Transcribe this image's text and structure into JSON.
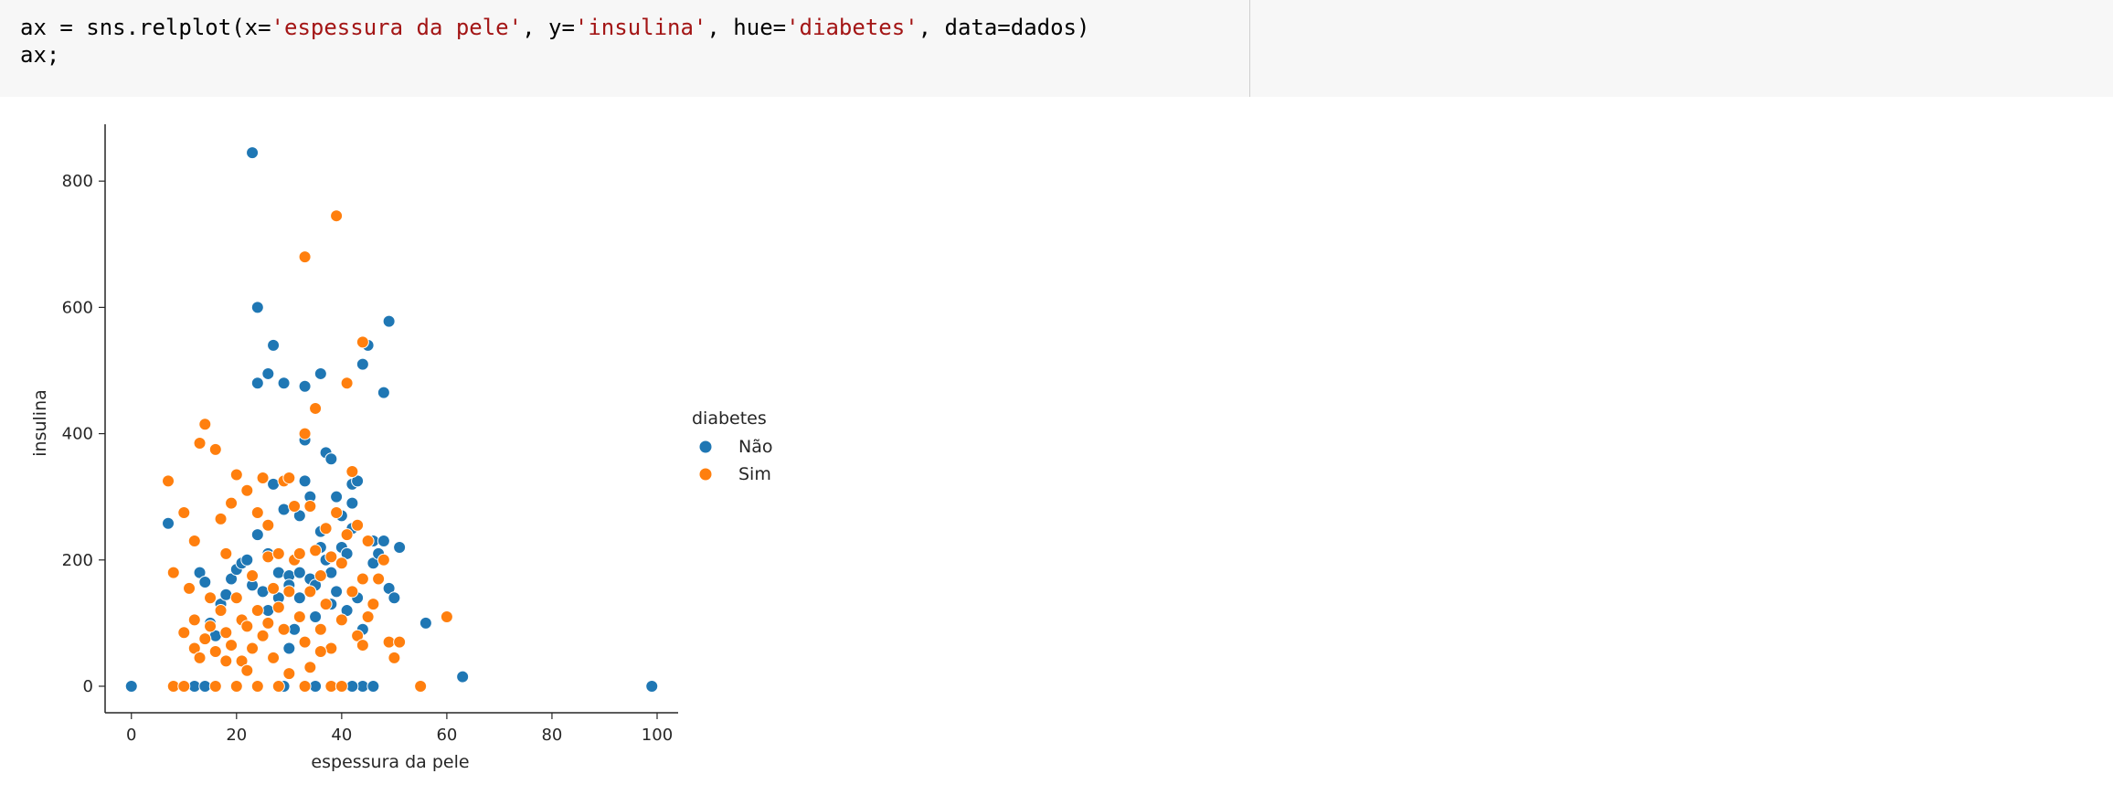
{
  "code_cell": {
    "line1_parts": [
      {
        "text": "ax = sns.relplot(x=",
        "kind": "plain"
      },
      {
        "text": "'espessura da pele'",
        "kind": "str"
      },
      {
        "text": ", y=",
        "kind": "plain"
      },
      {
        "text": "'insulina'",
        "kind": "str"
      },
      {
        "text": ", hue=",
        "kind": "plain"
      },
      {
        "text": "'diabetes'",
        "kind": "str"
      },
      {
        "text": ", data=dados)",
        "kind": "plain"
      }
    ],
    "line2": "ax;"
  },
  "chart_data": {
    "type": "scatter",
    "xlabel": "espessura da pele",
    "ylabel": "insulina",
    "xlim": [
      -5,
      104
    ],
    "ylim": [
      -42,
      890
    ],
    "x_ticks": [
      0,
      20,
      40,
      60,
      80,
      100
    ],
    "y_ticks": [
      0,
      200,
      400,
      600,
      800
    ],
    "grid": false,
    "legend": {
      "title": "diabetes",
      "placement": "right"
    },
    "series": [
      {
        "name": "Não",
        "color": "#1f77b4",
        "points": [
          [
            0,
            0
          ],
          [
            7,
            258
          ],
          [
            12,
            0
          ],
          [
            13,
            180
          ],
          [
            14,
            165
          ],
          [
            15,
            100
          ],
          [
            16,
            80
          ],
          [
            17,
            130
          ],
          [
            18,
            145
          ],
          [
            19,
            170
          ],
          [
            20,
            185
          ],
          [
            21,
            195
          ],
          [
            22,
            200
          ],
          [
            23,
            845
          ],
          [
            23,
            160
          ],
          [
            24,
            600
          ],
          [
            24,
            480
          ],
          [
            24,
            240
          ],
          [
            25,
            150
          ],
          [
            26,
            495
          ],
          [
            26,
            120
          ],
          [
            27,
            540
          ],
          [
            27,
            320
          ],
          [
            28,
            180
          ],
          [
            28,
            140
          ],
          [
            29,
            480
          ],
          [
            29,
            280
          ],
          [
            30,
            175
          ],
          [
            30,
            160
          ],
          [
            31,
            90
          ],
          [
            32,
            270
          ],
          [
            32,
            140
          ],
          [
            33,
            475
          ],
          [
            33,
            390
          ],
          [
            33,
            325
          ],
          [
            34,
            300
          ],
          [
            34,
            170
          ],
          [
            35,
            160
          ],
          [
            35,
            0
          ],
          [
            36,
            495
          ],
          [
            36,
            245
          ],
          [
            36,
            220
          ],
          [
            37,
            370
          ],
          [
            37,
            200
          ],
          [
            38,
            360
          ],
          [
            38,
            180
          ],
          [
            39,
            300
          ],
          [
            39,
            150
          ],
          [
            40,
            270
          ],
          [
            40,
            220
          ],
          [
            41,
            210
          ],
          [
            41,
            120
          ],
          [
            42,
            320
          ],
          [
            42,
            290
          ],
          [
            42,
            250
          ],
          [
            43,
            325
          ],
          [
            43,
            140
          ],
          [
            44,
            510
          ],
          [
            45,
            540
          ],
          [
            46,
            230
          ],
          [
            46,
            195
          ],
          [
            47,
            210
          ],
          [
            48,
            465
          ],
          [
            48,
            230
          ],
          [
            49,
            578
          ],
          [
            49,
            155
          ],
          [
            50,
            140
          ],
          [
            51,
            220
          ],
          [
            56,
            100
          ],
          [
            63,
            15
          ],
          [
            99,
            0
          ],
          [
            44,
            0
          ],
          [
            46,
            0
          ],
          [
            42,
            0
          ],
          [
            29,
            0
          ],
          [
            14,
            0
          ],
          [
            30,
            60
          ],
          [
            35,
            110
          ],
          [
            44,
            90
          ],
          [
            38,
            130
          ],
          [
            26,
            210
          ],
          [
            32,
            180
          ]
        ]
      },
      {
        "name": "Sim",
        "color": "#ff7f0e",
        "points": [
          [
            7,
            325
          ],
          [
            8,
            180
          ],
          [
            10,
            275
          ],
          [
            10,
            85
          ],
          [
            11,
            155
          ],
          [
            12,
            230
          ],
          [
            12,
            60
          ],
          [
            13,
            385
          ],
          [
            13,
            45
          ],
          [
            14,
            415
          ],
          [
            14,
            75
          ],
          [
            15,
            140
          ],
          [
            15,
            95
          ],
          [
            16,
            375
          ],
          [
            16,
            55
          ],
          [
            17,
            265
          ],
          [
            17,
            120
          ],
          [
            18,
            210
          ],
          [
            18,
            85
          ],
          [
            19,
            290
          ],
          [
            19,
            65
          ],
          [
            20,
            335
          ],
          [
            20,
            140
          ],
          [
            21,
            105
          ],
          [
            21,
            40
          ],
          [
            22,
            310
          ],
          [
            22,
            95
          ],
          [
            23,
            175
          ],
          [
            23,
            60
          ],
          [
            24,
            275
          ],
          [
            24,
            120
          ],
          [
            25,
            330
          ],
          [
            25,
            80
          ],
          [
            26,
            205
          ],
          [
            26,
            100
          ],
          [
            27,
            155
          ],
          [
            27,
            45
          ],
          [
            28,
            210
          ],
          [
            28,
            125
          ],
          [
            29,
            325
          ],
          [
            29,
            90
          ],
          [
            30,
            330
          ],
          [
            30,
            150
          ],
          [
            31,
            285
          ],
          [
            31,
            200
          ],
          [
            32,
            210
          ],
          [
            32,
            110
          ],
          [
            33,
            680
          ],
          [
            33,
            400
          ],
          [
            33,
            70
          ],
          [
            34,
            285
          ],
          [
            34,
            150
          ],
          [
            35,
            440
          ],
          [
            35,
            215
          ],
          [
            36,
            175
          ],
          [
            36,
            90
          ],
          [
            37,
            250
          ],
          [
            37,
            130
          ],
          [
            38,
            205
          ],
          [
            38,
            60
          ],
          [
            39,
            745
          ],
          [
            39,
            275
          ],
          [
            40,
            195
          ],
          [
            40,
            105
          ],
          [
            41,
            480
          ],
          [
            41,
            240
          ],
          [
            42,
            340
          ],
          [
            42,
            150
          ],
          [
            43,
            255
          ],
          [
            43,
            80
          ],
          [
            44,
            545
          ],
          [
            44,
            170
          ],
          [
            45,
            230
          ],
          [
            45,
            110
          ],
          [
            46,
            130
          ],
          [
            47,
            170
          ],
          [
            48,
            200
          ],
          [
            49,
            70
          ],
          [
            50,
            45
          ],
          [
            51,
            70
          ],
          [
            55,
            0
          ],
          [
            60,
            110
          ],
          [
            8,
            0
          ],
          [
            10,
            0
          ],
          [
            16,
            0
          ],
          [
            20,
            0
          ],
          [
            24,
            0
          ],
          [
            28,
            0
          ],
          [
            33,
            0
          ],
          [
            38,
            0
          ],
          [
            40,
            0
          ],
          [
            26,
            255
          ],
          [
            34,
            30
          ],
          [
            12,
            105
          ],
          [
            18,
            40
          ],
          [
            22,
            25
          ],
          [
            30,
            20
          ],
          [
            36,
            55
          ],
          [
            44,
            65
          ]
        ]
      }
    ]
  }
}
